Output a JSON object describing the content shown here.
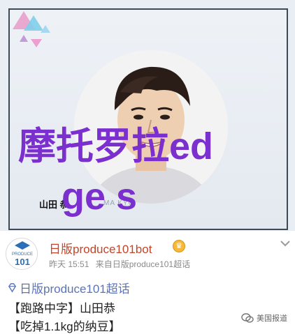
{
  "overlay": {
    "line1": "摩托罗拉ed",
    "line2": "ge s",
    "color": "#7b2fcf"
  },
  "card": {
    "name": "山田 恭",
    "watermark": "MA   KYO"
  },
  "post": {
    "avatar_text_top": "PRODUCE",
    "avatar_text_num": "101",
    "author": "日版produce101bot",
    "badge_icon": "crown-icon",
    "time": "昨天 15:51",
    "source": "来自日版produce101超话",
    "topic": "日版produce101超话",
    "line1": "【跑路中字】山田恭",
    "line2": "【吃掉1.1kg的纳豆】",
    "author_color": "#c3442b",
    "topic_color": "#5b74b8"
  },
  "corner_watermark": "美国报道"
}
